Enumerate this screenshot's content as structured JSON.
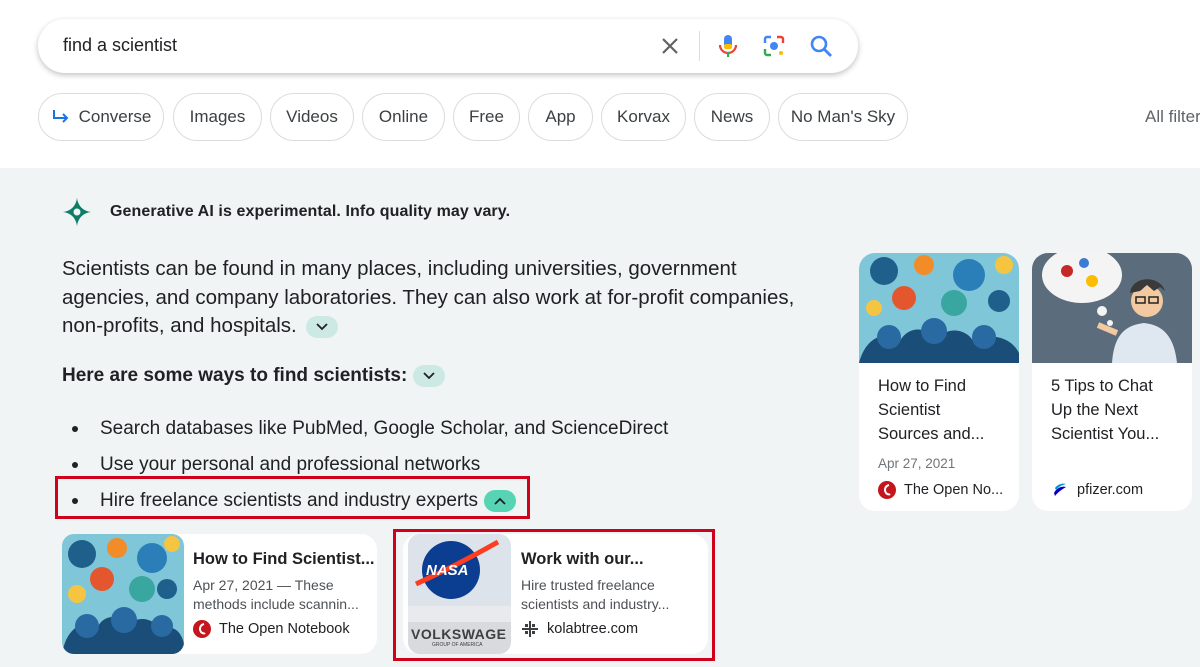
{
  "search": {
    "query": "find a scientist"
  },
  "chips": [
    {
      "label": "Converse"
    },
    {
      "label": "Images"
    },
    {
      "label": "Videos"
    },
    {
      "label": "Online"
    },
    {
      "label": "Free"
    },
    {
      "label": "App"
    },
    {
      "label": "Korvax"
    },
    {
      "label": "News"
    },
    {
      "label": "No Man's Sky"
    }
  ],
  "all_filters": "All filters",
  "ai": {
    "disclaimer": "Generative AI is experimental. Info quality may vary.",
    "summary": "Scientists can be found in many places, including universities, government agencies, and company laboratories. They can also work at for-profit companies, non-profits, and hospitals.",
    "ways_title": "Here are some ways to find scientists:",
    "bullets": [
      "Search databases like PubMed, Google Scholar, and ScienceDirect",
      "Use your personal and professional networks",
      "Hire freelance scientists and industry experts"
    ]
  },
  "source_cards": [
    {
      "title": "How to Find Scientist...",
      "desc_line1": "Apr 27, 2021 — These",
      "desc_line2": "methods include scannin...",
      "site": "The Open Notebook"
    },
    {
      "title": "Work with our...",
      "desc_line1": "Hire trusted freelance",
      "desc_line2": "scientists and industry...",
      "site": "kolabtree.com",
      "thumb_text_top": "NASA",
      "thumb_text_bottom": "VOLKSWAGE",
      "thumb_text_sub": "GROUP OF AMERICA"
    }
  ],
  "side_cards": [
    {
      "title_line1": "How to Find",
      "title_line2": "Scientist",
      "title_line3": "Sources and...",
      "date": "Apr 27, 2021",
      "site": "The Open No..."
    },
    {
      "title_line1": "5 Tips to Chat",
      "title_line2": "Up the Next",
      "title_line3": "Scientist You...",
      "site": "pfizer.com"
    }
  ],
  "colors": {
    "accent_red": "#d0021b",
    "panel_bg": "#f0f4f4",
    "teal": "#0b7d68"
  }
}
